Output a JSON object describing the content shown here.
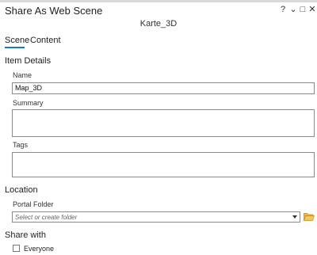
{
  "window": {
    "title": "Share As Web Scene",
    "help_glyph": "?",
    "menu_glyph": "⌄",
    "maximize_glyph": "□",
    "close_glyph": "✕",
    "subtitle": "Karte_3D"
  },
  "tabs": [
    {
      "label": "Scene",
      "active": true
    },
    {
      "label": "Content",
      "active": false
    }
  ],
  "item_details": {
    "heading": "Item Details",
    "name_label": "Name",
    "name_value": "Map_3D",
    "summary_label": "Summary",
    "summary_value": "",
    "tags_label": "Tags",
    "tags_value": ""
  },
  "location": {
    "heading": "Location",
    "portal_folder_label": "Portal Folder",
    "portal_folder_placeholder": "Select or create folder"
  },
  "share_with": {
    "heading": "Share with",
    "everyone_label": "Everyone",
    "everyone_checked": false
  },
  "colors": {
    "accent": "#1e78c8",
    "folder_icon": "#e0a326"
  }
}
